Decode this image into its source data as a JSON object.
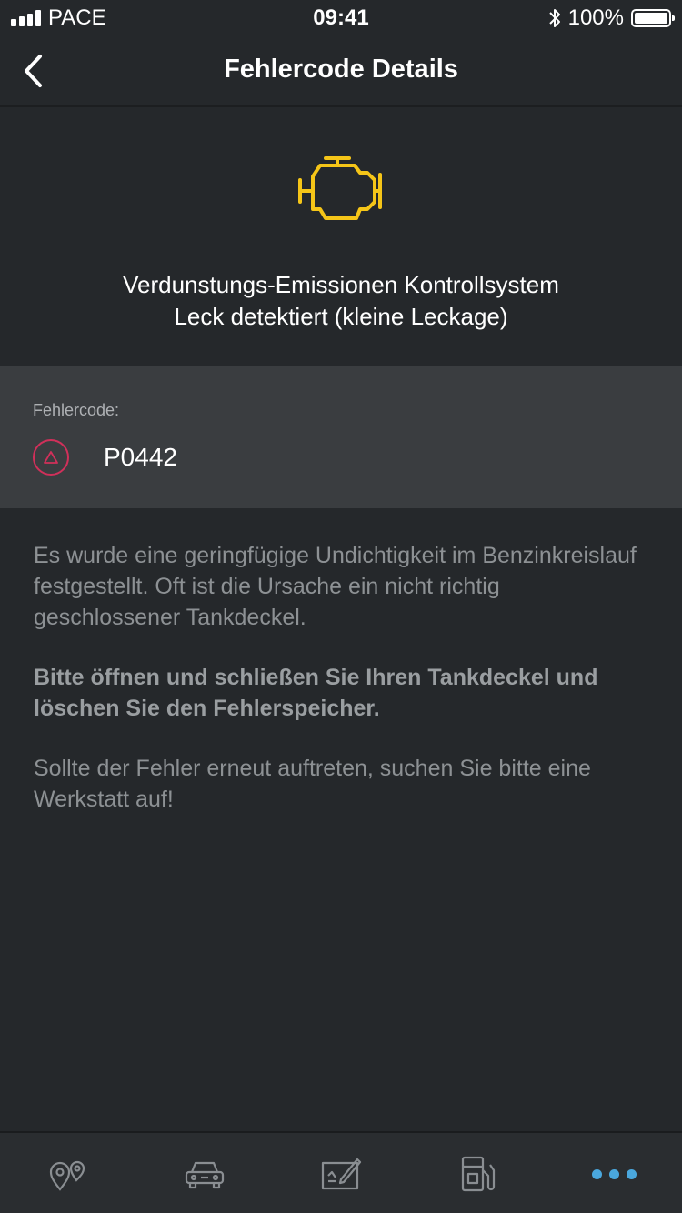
{
  "status_bar": {
    "carrier": "PACE",
    "time": "09:41",
    "battery": "100%",
    "bluetooth_icon": "bluetooth-icon"
  },
  "nav": {
    "title": "Fehlercode Details",
    "back_icon": "chevron-left-icon"
  },
  "hero": {
    "icon": "engine-warning-icon",
    "icon_color": "#f5c518",
    "line1": "Verdunstungs-Emissionen Kontrollsystem",
    "line2": "Leck detektiert (kleine Leckage)"
  },
  "code": {
    "label": "Fehlercode:",
    "value": "P0442",
    "badge_icon": "warning-triangle-icon",
    "badge_color": "#d0305a"
  },
  "description": {
    "paragraph1": "Es wurde eine geringfügige Undichtigkeit im Benzinkreislauf festgestellt. Oft ist die Ursache ein nicht richtig geschlossener Tankdeckel.",
    "paragraph2": "Bitte öffnen und schließen Sie Ihren Tankdeckel und löschen Sie den Fehlerspeicher.",
    "paragraph3": "Sollte der Fehler erneut auftreten, suchen Sie bitte eine Werkstatt auf!"
  },
  "tab_bar": {
    "items": [
      {
        "icon": "map-pins-icon"
      },
      {
        "icon": "car-icon"
      },
      {
        "icon": "logbook-icon"
      },
      {
        "icon": "fuel-pump-icon"
      },
      {
        "icon": "more-icon",
        "active_color": "#4aa7dd"
      }
    ]
  }
}
